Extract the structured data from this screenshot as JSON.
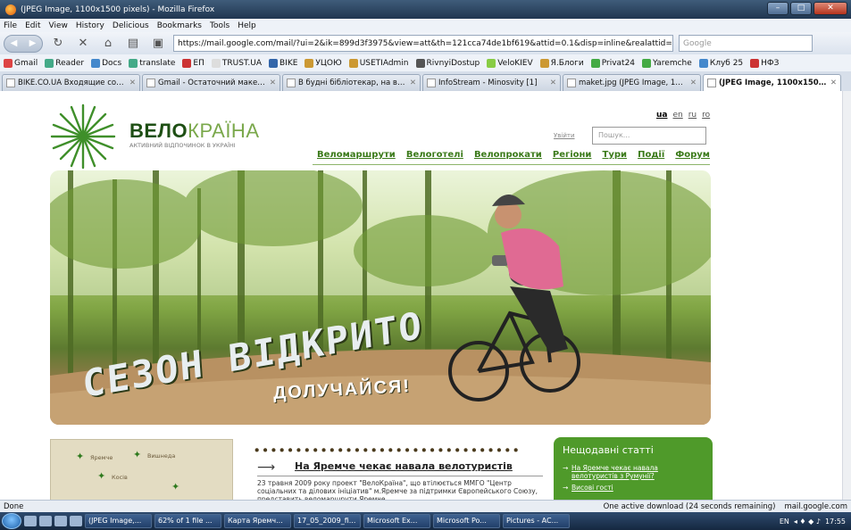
{
  "window": {
    "title": "(JPEG Image, 1100x1500 pixels) - Mozilla Firefox"
  },
  "menu": [
    "File",
    "Edit",
    "View",
    "History",
    "Delicious",
    "Bookmarks",
    "Tools",
    "Help"
  ],
  "url": "https://mail.google.com/mail/?ui=2&ik=899d3f3975&view=att&th=121cca74de1bf619&attid=0.1&disp=inline&realattid=f_fv",
  "search_placeholder": "Google",
  "bookmarks": [
    {
      "label": "Gmail",
      "color": "#d44"
    },
    {
      "label": "Reader",
      "color": "#4a8"
    },
    {
      "label": "Docs",
      "color": "#48c"
    },
    {
      "label": "translate",
      "color": "#4a8"
    },
    {
      "label": "ЕП",
      "color": "#c33"
    },
    {
      "label": "TRUST.UA",
      "color": "#ddd"
    },
    {
      "label": "BIKE",
      "color": "#36a"
    },
    {
      "label": "УЦОЮ",
      "color": "#c93"
    },
    {
      "label": "USETIAdmin",
      "color": "#c93"
    },
    {
      "label": "RivnyiDostup",
      "color": "#555"
    },
    {
      "label": "VeloKIEV",
      "color": "#8c4"
    },
    {
      "label": "Я.Блоги",
      "color": "#c93"
    },
    {
      "label": "Privat24",
      "color": "#4a4"
    },
    {
      "label": "Yaremche",
      "color": "#4a4"
    },
    {
      "label": "Клуб 25",
      "color": "#48c"
    },
    {
      "label": "НФЗ",
      "color": "#c33"
    }
  ],
  "tabs": [
    {
      "label": "BIKE.CO.UA Входящие соо..."
    },
    {
      "label": "Gmail - Остаточний макет ..."
    },
    {
      "label": "В будні бібліотекар, на вих..."
    },
    {
      "label": "InfoStream - Minosvity [1]"
    },
    {
      "label": "maket.jpg (JPEG Image, 110..."
    },
    {
      "label": "(JPEG Image, 1100x1500 ..."
    }
  ],
  "site": {
    "brand_bold": "ВЕЛО",
    "brand_rest": "КРАЇНА",
    "tagline": "АКТИВНИЙ ВІДПОЧИНОК В УКРАЇНІ",
    "langs": [
      "ua",
      "en",
      "ru",
      "ro"
    ],
    "login": "Увійти",
    "search_placeholder": "Пошук...",
    "nav": [
      "Веломаршрути",
      "Велоготелі",
      "Велопрокати",
      "Регіони",
      "Тури",
      "Події",
      "Форум"
    ],
    "hero_line1": "СЕЗОН ВІДКРИТО",
    "hero_line2": "ДОЛУЧАЙСЯ!",
    "map_labels": [
      "Яремче",
      "Вишнеда",
      "Косів"
    ],
    "news_headline": "На Яремче чекає навала велотуристів",
    "news_body": "23 травня 2009 року проект \"ВелоКраїна\", що втілюється ММГО \"Центр соціальних та ділових ініціатив\" м.Яремче за підтримки Європейського Союзу, представить веломаршрути Яремче...",
    "recent_title": "Нещодавні статті",
    "recent_items": [
      "На Яремче чекає навала велотуристів з Румунії?",
      "Висові гості"
    ]
  },
  "status": {
    "left": "Done",
    "download": "One active download (24 seconds remaining)",
    "domain": "mail.google.com"
  },
  "taskbar": {
    "tasks": [
      "(JPEG Image,...",
      "62% of 1 file ...",
      "Карта Яремч...",
      "17_05_2009_fi...",
      "Microsoft Ex...",
      "Microsoft Po...",
      "Pictures - AC..."
    ],
    "lang": "EN",
    "clock": "17:55"
  }
}
